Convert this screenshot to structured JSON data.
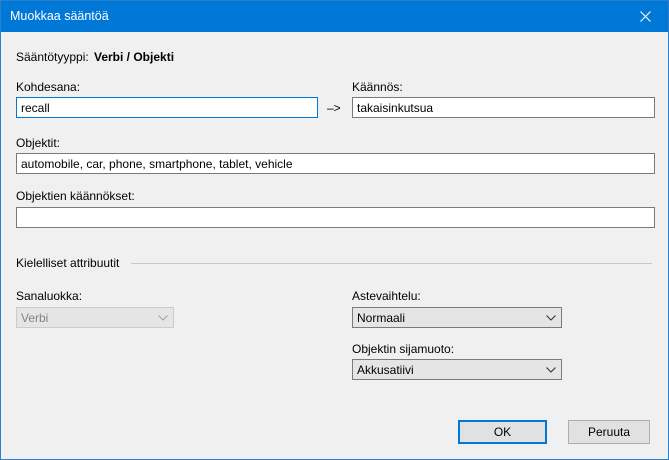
{
  "window": {
    "title": "Muokkaa sääntöä"
  },
  "rule_type": {
    "label": "Sääntötyyppi:",
    "value": "Verbi / Objekti"
  },
  "target_word": {
    "label": "Kohdesana:",
    "value": "recall"
  },
  "arrow": "–>",
  "translation": {
    "label": "Käännös:",
    "value": "takaisinkutsua"
  },
  "objects": {
    "label": "Objektit:",
    "value": "automobile, car, phone, smartphone, tablet, vehicle"
  },
  "object_translations": {
    "label": "Objektien käännökset:",
    "value": ""
  },
  "attributes": {
    "title": "Kielelliset attribuutit",
    "word_class": {
      "label": "Sanaluokka:",
      "value": "Verbi"
    },
    "gradation": {
      "label": "Astevaihtelu:",
      "value": "Normaali"
    },
    "object_case": {
      "label": "Objektin sijamuoto:",
      "value": "Akkusatiivi"
    }
  },
  "buttons": {
    "ok": "OK",
    "cancel": "Peruuta"
  },
  "icons": {
    "close": "close-icon",
    "dropdown": "chevron-down-icon"
  },
  "colors": {
    "accent": "#0078d7",
    "background": "#f0f0f0"
  }
}
